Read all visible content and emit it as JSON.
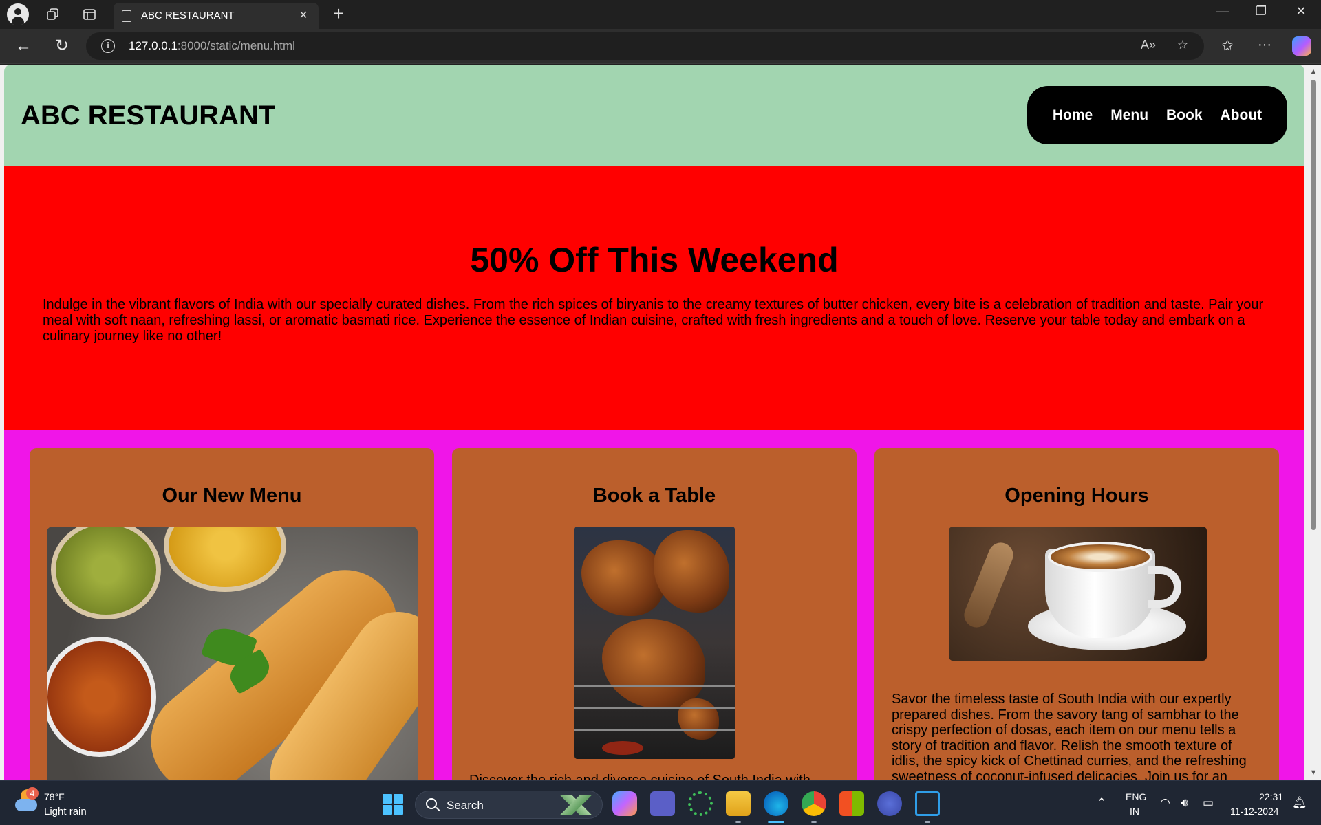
{
  "browser": {
    "tab_title": "ABC RESTAURANT",
    "url_host": "127.0.0.1",
    "url_rest": ":8000/static/menu.html"
  },
  "site": {
    "title": "ABC RESTAURANT",
    "nav": [
      "Home",
      "Menu",
      "Book",
      "About"
    ]
  },
  "promo": {
    "heading": "50% Off This Weekend",
    "text": "Indulge in the vibrant flavors of India with our specially curated dishes. From the rich spices of biryanis to the creamy textures of butter chicken, every bite is a celebration of tradition and taste. Pair your meal with soft naan, refreshing lassi, or aromatic basmati rice. Experience the essence of Indian cuisine, crafted with fresh ingredients and a touch of love. Reserve your table today and embark on a culinary journey like no other!"
  },
  "cards": [
    {
      "heading": "Our New Menu",
      "image": "dosa-platter",
      "text": ""
    },
    {
      "heading": "Book a Table",
      "image": "grilled-chicken",
      "text": "Discover the rich and diverse cuisine of South India with"
    },
    {
      "heading": "Opening Hours",
      "image": "latte-cup",
      "text": "Savor the timeless taste of South India with our expertly prepared dishes. From the savory tang of sambhar to the crispy perfection of dosas, each item on our menu tells a story of tradition and flavor. Relish the smooth texture of idlis, the spicy kick of Chettinad curries, and the refreshing sweetness of coconut-infused delicacies. Join us for an unforgettable journey through the authentic flavors of the"
    }
  ],
  "colors": {
    "header_bg": "#a2d5b0",
    "promo_bg": "#ff0000",
    "cards_bg": "#f015e8",
    "card_bg": "#bb5f2c"
  },
  "taskbar": {
    "weather_badge": "4",
    "weather_temp": "78°F",
    "weather_desc": "Light rain",
    "search_label": "Search",
    "lang_top": "ENG",
    "lang_bottom": "IN",
    "time": "22:31",
    "date": "11-12-2024"
  }
}
